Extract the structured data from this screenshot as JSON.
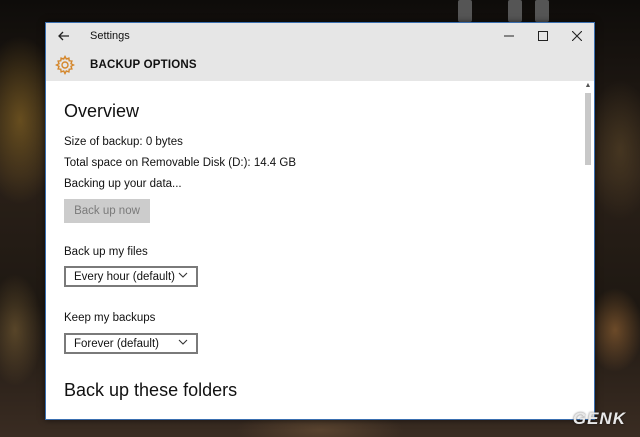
{
  "window": {
    "title": "Settings",
    "back_icon": "back-arrow-icon",
    "controls": [
      "minimize-icon",
      "maximize-icon",
      "close-icon"
    ]
  },
  "header": {
    "icon": "gear-icon",
    "accent_color": "#d4862a",
    "title": "BACKUP OPTIONS"
  },
  "overview": {
    "heading": "Overview",
    "size_of_backup": "Size of backup: 0 bytes",
    "total_space": "Total space on Removable Disk (D:): 14.4 GB",
    "status": "Backing up your data...",
    "back_up_now_label": "Back up now"
  },
  "backup_files": {
    "label": "Back up my files",
    "selected": "Every hour (default)"
  },
  "keep_backups": {
    "label": "Keep my backups",
    "selected": "Forever (default)"
  },
  "folders": {
    "heading": "Back up these folders"
  },
  "watermark": "GENK"
}
